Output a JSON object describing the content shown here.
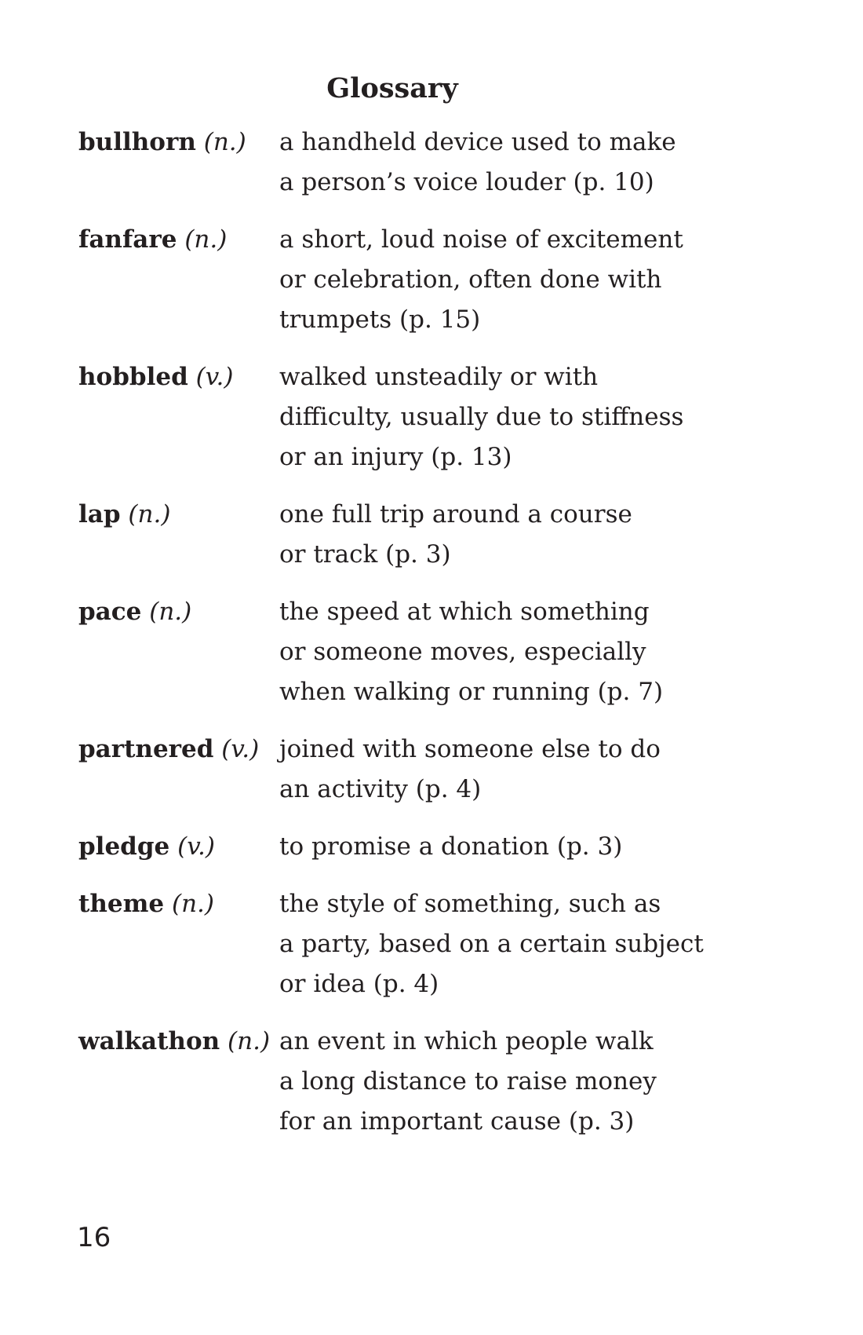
{
  "title": "Glossary",
  "entries": [
    {
      "term": "bullhorn",
      "pos": "(n.)",
      "definition_lines": [
        "a handheld device used to make",
        "a person’s voice louder (p. 10)"
      ]
    },
    {
      "term": "fanfare",
      "pos": "(n.)",
      "definition_lines": [
        "a short, loud noise of excitement",
        "or celebration, often done with",
        "trumpets (p. 15)"
      ]
    },
    {
      "term": "hobbled",
      "pos": "(v.)",
      "definition_lines": [
        "walked unsteadily or with",
        "difficulty, usually due to stiffness",
        "or an injury (p. 13)"
      ]
    },
    {
      "term": "lap",
      "pos": "(n.)",
      "definition_lines": [
        "one full trip around a course",
        "or track (p. 3)"
      ]
    },
    {
      "term": "pace",
      "pos": "(n.)",
      "definition_lines": [
        "the speed at which something",
        "or someone moves, especially",
        "when walking or running (p. 7)"
      ]
    },
    {
      "term": "partnered",
      "pos": "(v.)",
      "definition_lines": [
        "joined with someone else to do",
        "an activity (p. 4)"
      ]
    },
    {
      "term": "pledge",
      "pos": "(v.)",
      "definition_lines": [
        "to promise a donation (p. 3)"
      ]
    },
    {
      "term": "theme",
      "pos": "(n.)",
      "definition_lines": [
        "the style of something, such as",
        "a party, based on a certain subject",
        "or idea (p. 4)"
      ]
    },
    {
      "term": "walkathon",
      "pos": "(n.)",
      "definition_lines": [
        "an event in which people walk",
        "a long distance to raise money",
        "for an important cause (p. 3)"
      ]
    }
  ],
  "page_number": "16"
}
